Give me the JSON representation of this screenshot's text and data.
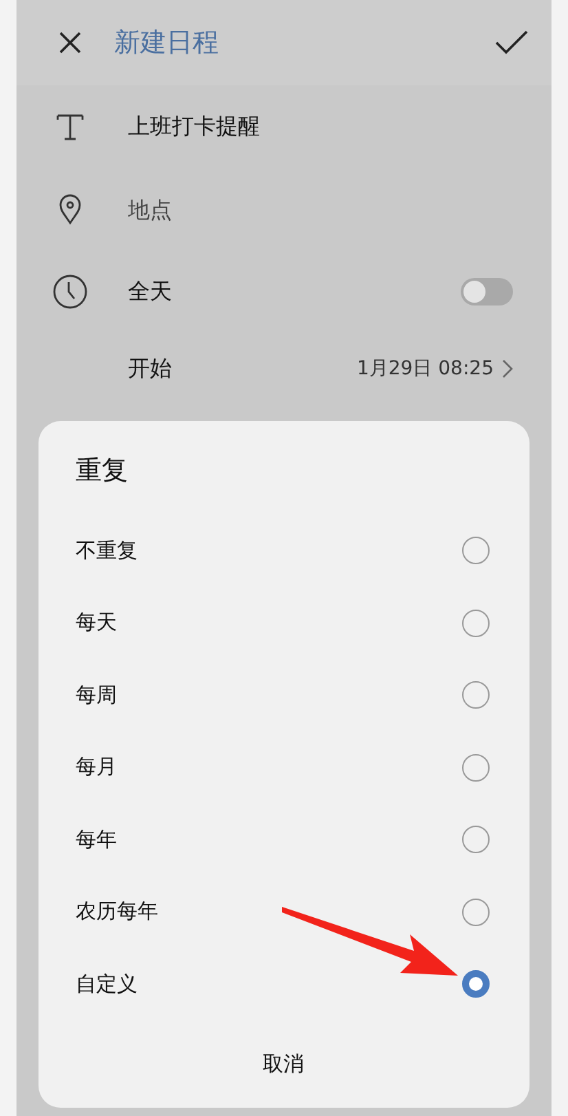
{
  "header": {
    "title": "新建日程"
  },
  "form": {
    "title_value": "上班打卡提醒",
    "location_placeholder": "地点",
    "all_day": {
      "label": "全天",
      "on": false
    },
    "start": {
      "label": "开始",
      "value": "1月29日 08:25"
    }
  },
  "dialog": {
    "title": "重复",
    "options": [
      {
        "label": "不重复",
        "selected": false
      },
      {
        "label": "每天",
        "selected": false
      },
      {
        "label": "每周",
        "selected": false
      },
      {
        "label": "每月",
        "selected": false
      },
      {
        "label": "每年",
        "selected": false
      },
      {
        "label": "农历每年",
        "selected": false
      },
      {
        "label": "自定义",
        "selected": true
      }
    ],
    "cancel": "取消"
  }
}
